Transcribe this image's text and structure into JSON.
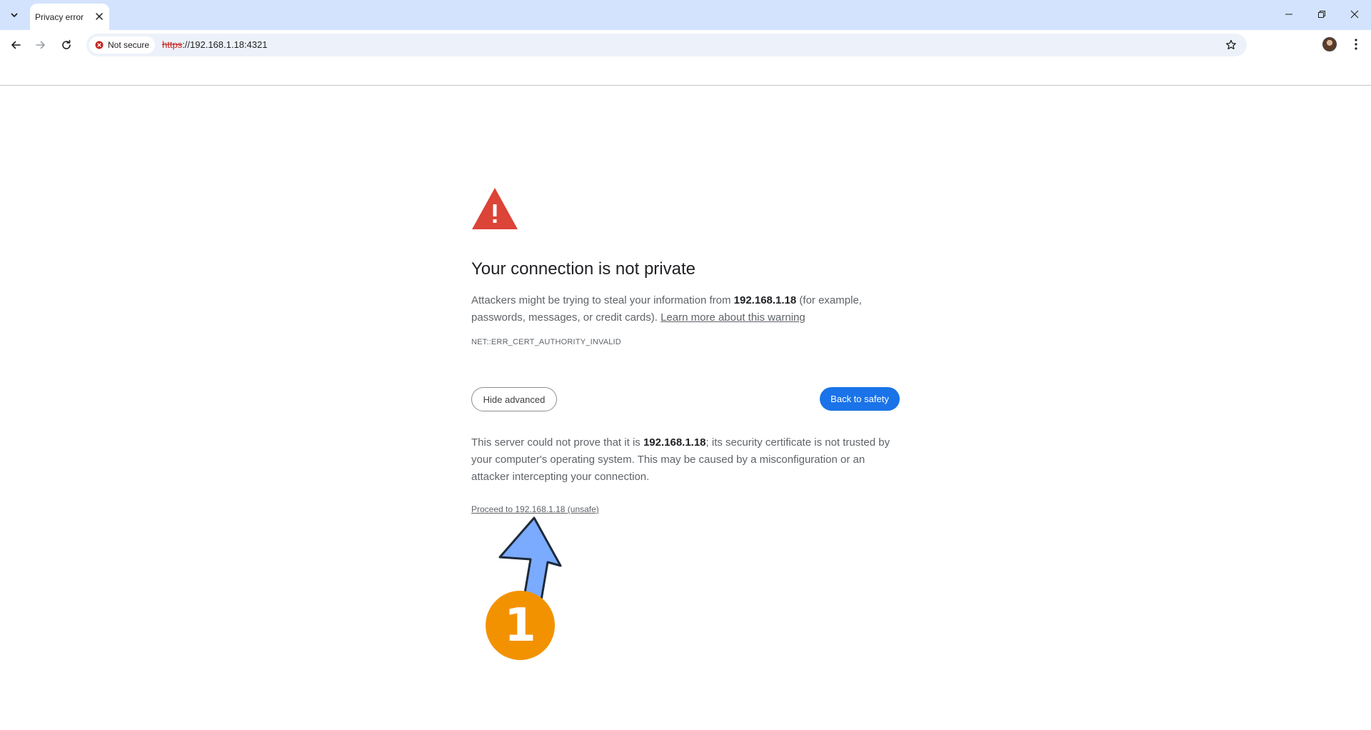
{
  "tab": {
    "title": "Privacy error"
  },
  "omnibox": {
    "security_label": "Not secure",
    "url_scheme": "https",
    "url_rest": "://192.168.1.18:4321"
  },
  "interstitial": {
    "heading": "Your connection is not private",
    "explanation_prefix": "Attackers might be trying to steal your information from ",
    "explanation_host": "192.168.1.18",
    "explanation_suffix": " (for example, passwords, messages, or credit cards). ",
    "learn_more_link": "Learn more about this warning",
    "error_code": "NET::ERR_CERT_AUTHORITY_INVALID",
    "hide_advanced_label": "Hide advanced",
    "back_to_safety_label": "Back to safety",
    "details_prefix": "This server could not prove that it is ",
    "details_host": "192.168.1.18",
    "details_suffix": "; its security certificate is not trusted by your computer's operating system. This may be caused by a misconfiguration or an attacker intercepting your connection.",
    "proceed_link": "Proceed to 192.168.1.18 (unsafe)"
  },
  "annotation": {
    "step_number": "1"
  },
  "colors": {
    "tabstrip_bg": "#d3e3fd",
    "warning_red": "#db4437",
    "primary_blue": "#1a73e8",
    "annotation_orange": "#f39200",
    "annotation_arrow_blue": "#7aabff"
  }
}
